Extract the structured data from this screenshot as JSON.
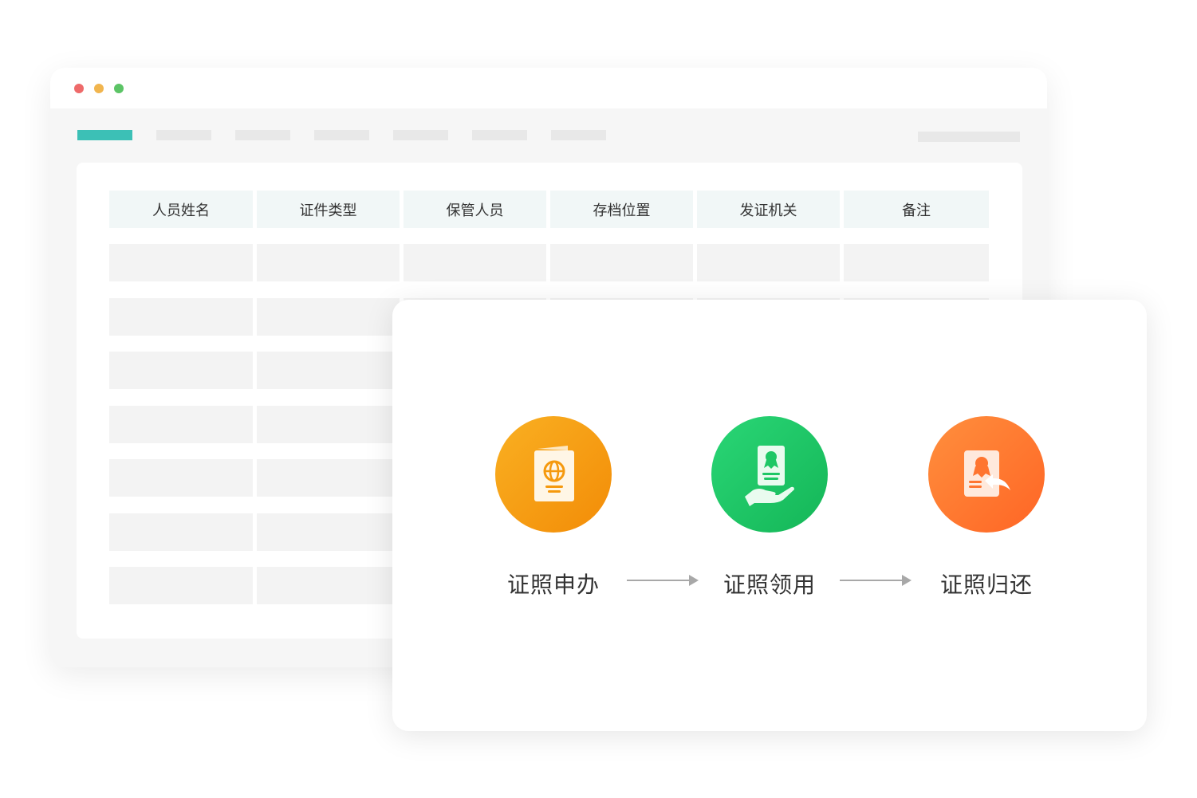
{
  "window": {
    "controls": [
      "close",
      "minimize",
      "maximize"
    ],
    "nav": {
      "tab_count": 7,
      "active_index": 0
    },
    "table": {
      "headers": [
        "人员姓名",
        "证件类型",
        "保管人员",
        "存档位置",
        "发证机关",
        "备注"
      ],
      "placeholder_rows": 7
    }
  },
  "flow": {
    "steps": [
      {
        "label": "证照申办",
        "icon": "passport-icon",
        "color": "#f5990e"
      },
      {
        "label": "证照领用",
        "icon": "certificate-hand-icon",
        "color": "#1fc766"
      },
      {
        "label": "证照归还",
        "icon": "certificate-return-icon",
        "color": "#ff7530"
      }
    ]
  },
  "colors": {
    "accent": "#3cc0b6",
    "table_header_bg": "#f1f7f7",
    "placeholder": "#f3f3f3"
  }
}
